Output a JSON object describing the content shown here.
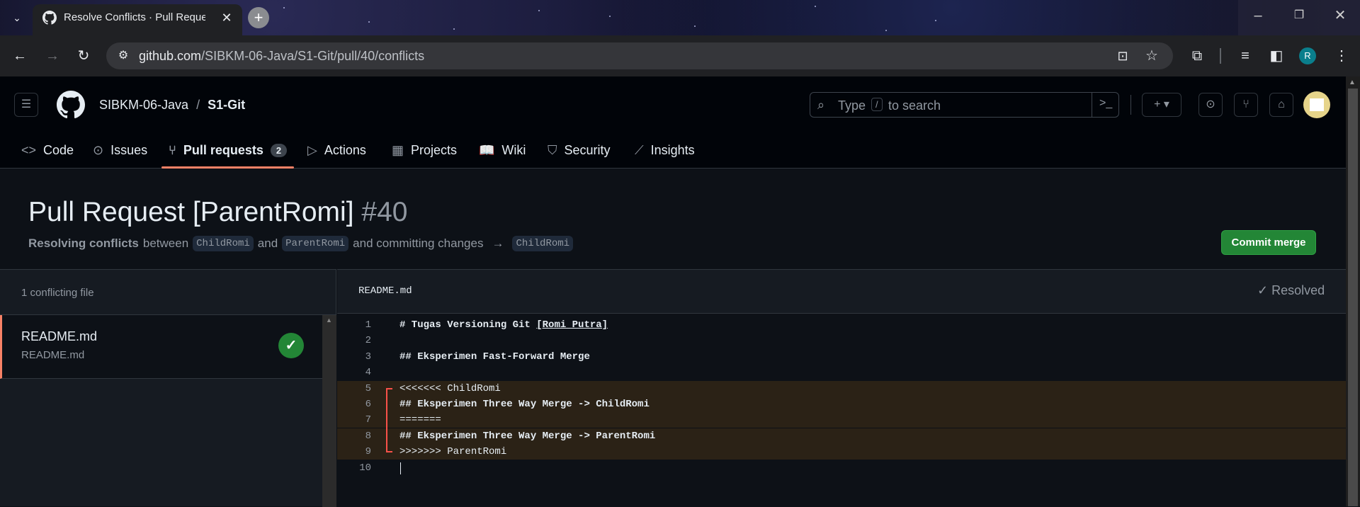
{
  "browser": {
    "tab_title": "Resolve Conflicts · Pull Request",
    "url_host": "github.com",
    "url_path": "/SIBKM-06-Java/S1-Git/pull/40/conflicts",
    "profile_initial": "R"
  },
  "header": {
    "owner": "SIBKM-06-Java",
    "separator": "/",
    "repo": "S1-Git",
    "search_placeholder_pre": "Type",
    "search_key": "/",
    "search_placeholder_post": "to search"
  },
  "nav": [
    {
      "label": "Code",
      "icon": "code-icon"
    },
    {
      "label": "Issues",
      "icon": "issue-icon"
    },
    {
      "label": "Pull requests",
      "icon": "pull-request-icon",
      "count": "2"
    },
    {
      "label": "Actions",
      "icon": "play-icon"
    },
    {
      "label": "Projects",
      "icon": "table-icon"
    },
    {
      "label": "Wiki",
      "icon": "book-icon"
    },
    {
      "label": "Security",
      "icon": "shield-icon"
    },
    {
      "label": "Insights",
      "icon": "graph-icon"
    }
  ],
  "pr": {
    "title": "Pull Request [ParentRomi]",
    "number": "#40",
    "resolving": "Resolving conflicts",
    "between": "between",
    "head_branch": "ChildRomi",
    "and": "and",
    "base_branch": "ParentRomi",
    "committing": "and committing changes",
    "arrow": "→",
    "target_branch": "ChildRomi",
    "commit_button": "Commit merge"
  },
  "files": {
    "count_label": "1 conflicting file",
    "items": [
      {
        "name": "README.md",
        "path": "README.md"
      }
    ]
  },
  "editor": {
    "filename": "README.md",
    "resolved_label": "Resolved",
    "lines": [
      {
        "n": "1",
        "text": "# Tugas Versioning Git ",
        "link": "[Romi Putra]",
        "bold": true
      },
      {
        "n": "2",
        "text": ""
      },
      {
        "n": "3",
        "text": "## Eksperimen Fast-Forward Merge",
        "bold": true
      },
      {
        "n": "4",
        "text": ""
      },
      {
        "n": "5",
        "text": "<<<<<<< ChildRomi",
        "conflict": true
      },
      {
        "n": "6",
        "text": "## Eksperimen Three Way Merge -> ChildRomi",
        "bold": true,
        "conflict": true
      },
      {
        "n": "7",
        "text": "=======",
        "conflict": true
      },
      {
        "n": "8",
        "text": "## Eksperimen Three Way Merge -> ParentRomi",
        "bold": true,
        "conflict": true
      },
      {
        "n": "9",
        "text": ">>>>>>> ParentRomi",
        "conflict": true
      },
      {
        "n": "10",
        "text": ""
      }
    ]
  },
  "colors": {
    "accent_green": "#238636",
    "conflict_red": "#f85149",
    "active_tab_underline": "#f78166"
  }
}
